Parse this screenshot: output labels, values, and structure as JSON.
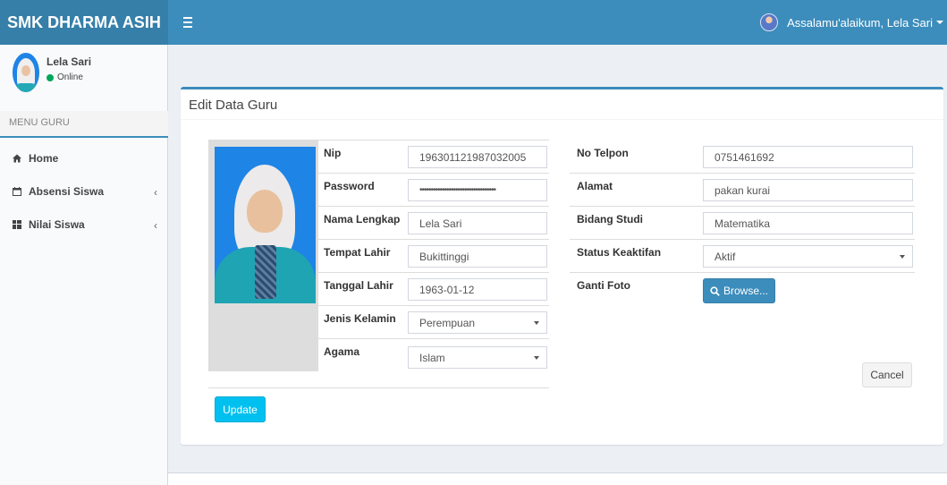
{
  "header": {
    "logo": "SMK DHARMA ASIH",
    "greeting": "Assalamu'alaikum, Lela Sari"
  },
  "sidebar": {
    "user_name": "Lela Sari",
    "status": "Online",
    "menu_header": "MENU GURU",
    "items": [
      {
        "label": "Home",
        "icon": "home-icon"
      },
      {
        "label": "Absensi Siswa",
        "icon": "calendar-icon",
        "expand": "‹"
      },
      {
        "label": "Nilai Siswa",
        "icon": "grid-icon",
        "expand": "‹"
      }
    ]
  },
  "form": {
    "title": "Edit Data Guru",
    "left": [
      {
        "label": "Nip",
        "value": "196301121987032005",
        "type": "text"
      },
      {
        "label": "Password",
        "value": "••••••••••••••••••••••••••••••••••",
        "type": "password"
      },
      {
        "label": "Nama Lengkap",
        "value": "Lela Sari",
        "type": "text"
      },
      {
        "label": "Tempat Lahir",
        "value": "Bukittinggi",
        "type": "text"
      },
      {
        "label": "Tanggal Lahir",
        "value": "1963-01-12",
        "type": "text"
      },
      {
        "label": "Jenis Kelamin",
        "value": "Perempuan",
        "type": "select"
      },
      {
        "label": "Agama",
        "value": "Islam",
        "type": "select"
      }
    ],
    "right": [
      {
        "label": "No Telpon",
        "value": "0751461692",
        "type": "text"
      },
      {
        "label": "Alamat",
        "value": "pakan kurai",
        "type": "text"
      },
      {
        "label": "Bidang Studi",
        "value": "Matematika",
        "type": "text"
      },
      {
        "label": "Status Keaktifan",
        "value": "Aktif",
        "type": "select"
      }
    ],
    "photo_label": "Ganti Foto",
    "browse_label": "Browse...",
    "cancel_label": "Cancel",
    "update_label": "Update"
  },
  "colors": {
    "header": "#3c8dbc",
    "logo_bg": "#367fa9",
    "update_button": "#00c0ef",
    "online": "#00a65a"
  }
}
